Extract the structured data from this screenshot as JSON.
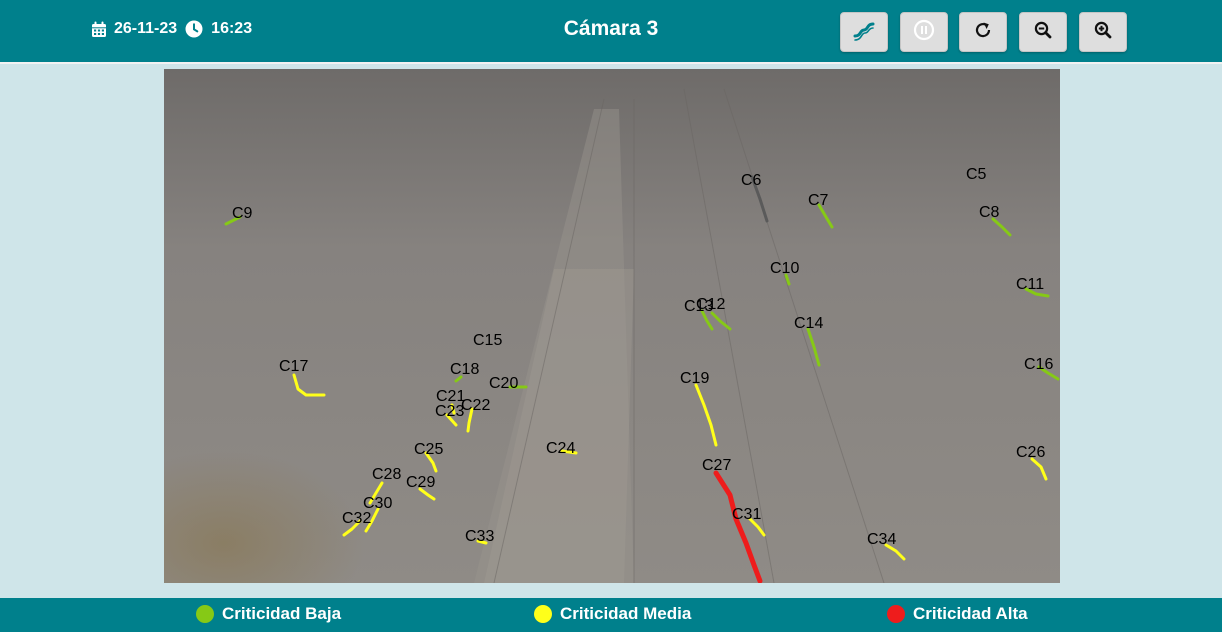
{
  "header": {
    "title": "Cámara 3",
    "date": "26-11-23",
    "time": "16:23",
    "buttons": [
      {
        "name": "route-button",
        "icon": "route-icon"
      },
      {
        "name": "pause-button",
        "icon": "pause-icon"
      },
      {
        "name": "refresh-button",
        "icon": "refresh-icon"
      },
      {
        "name": "zoom-out-button",
        "icon": "zoom-out-icon"
      },
      {
        "name": "zoom-in-button",
        "icon": "zoom-in-icon"
      }
    ]
  },
  "colors": {
    "header_bg": "#00808c",
    "page_bg": "#cfe5e9",
    "low": "#86c916",
    "medium": "#ffff1a",
    "high": "#ee1c1c",
    "unclassified": "#5a5a5a"
  },
  "cracks": [
    {
      "id": "C5",
      "level": "none"
    },
    {
      "id": "C6",
      "level": "none"
    },
    {
      "id": "C7",
      "level": "low"
    },
    {
      "id": "C8",
      "level": "low"
    },
    {
      "id": "C9",
      "level": "low"
    },
    {
      "id": "C10",
      "level": "low"
    },
    {
      "id": "C11",
      "level": "low"
    },
    {
      "id": "C12",
      "level": "low"
    },
    {
      "id": "C13",
      "level": "low"
    },
    {
      "id": "C14",
      "level": "low"
    },
    {
      "id": "C15",
      "level": "none"
    },
    {
      "id": "C16",
      "level": "low"
    },
    {
      "id": "C17",
      "level": "medium"
    },
    {
      "id": "C18",
      "level": "low"
    },
    {
      "id": "C19",
      "level": "medium"
    },
    {
      "id": "C20",
      "level": "low"
    },
    {
      "id": "C21",
      "level": "medium"
    },
    {
      "id": "C22",
      "level": "medium"
    },
    {
      "id": "C23",
      "level": "medium"
    },
    {
      "id": "C24",
      "level": "medium"
    },
    {
      "id": "C25",
      "level": "medium"
    },
    {
      "id": "C26",
      "level": "medium"
    },
    {
      "id": "C27",
      "level": "high"
    },
    {
      "id": "C28",
      "level": "medium"
    },
    {
      "id": "C29",
      "level": "medium"
    },
    {
      "id": "C30",
      "level": "medium"
    },
    {
      "id": "C31",
      "level": "medium"
    },
    {
      "id": "C32",
      "level": "medium"
    },
    {
      "id": "C33",
      "level": "medium"
    },
    {
      "id": "C34",
      "level": "medium"
    }
  ],
  "legend": [
    {
      "label": "Criticidad Baja",
      "color": "#86c916"
    },
    {
      "label": "Criticidad Media",
      "color": "#ffff1a"
    },
    {
      "label": "Criticidad Alta",
      "color": "#ee1c1c"
    }
  ]
}
